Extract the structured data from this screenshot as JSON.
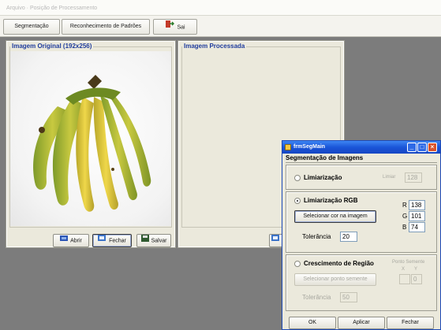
{
  "window": {
    "title": "Arquivo · Posição de Processamento"
  },
  "menubar": {
    "segmentacao": "Segmentação",
    "reconhecimento": "Reconhecimento de Padrões",
    "sair": "Sai"
  },
  "left_panel": {
    "title": "Imagem Original (192x256)",
    "abrir": "Abrir",
    "fechar": "Fechar",
    "salvar": "Salvar"
  },
  "right_panel": {
    "title": "Imagem Processada"
  },
  "dialog": {
    "title": "frmSegMain",
    "heading": "Segmentação de Imagens",
    "limiarizacao": {
      "label": "Limiarização",
      "limiar_label": "Limiar",
      "limiar_value": "128"
    },
    "rgb": {
      "label": "Limiarização RGB",
      "select_button": "Selecionar cor na imagem",
      "r_label": "R",
      "r_value": "138",
      "g_label": "G",
      "g_value": "101",
      "b_label": "B",
      "b_value": "74",
      "tolerancia_label": "Tolerância",
      "tolerancia_value": "20"
    },
    "crescimento": {
      "label": "Crescimento de Região",
      "ponto_label": "Ponto Semente",
      "x_label": "X",
      "y_label": "Y",
      "x_value": "",
      "y_value": "0",
      "select_button": "Selecionar ponto semente",
      "tolerancia_label": "Tolerância",
      "tolerancia_value": "50"
    },
    "ok": "OK",
    "aplicar": "Aplicar",
    "fechar": "Fechar"
  }
}
